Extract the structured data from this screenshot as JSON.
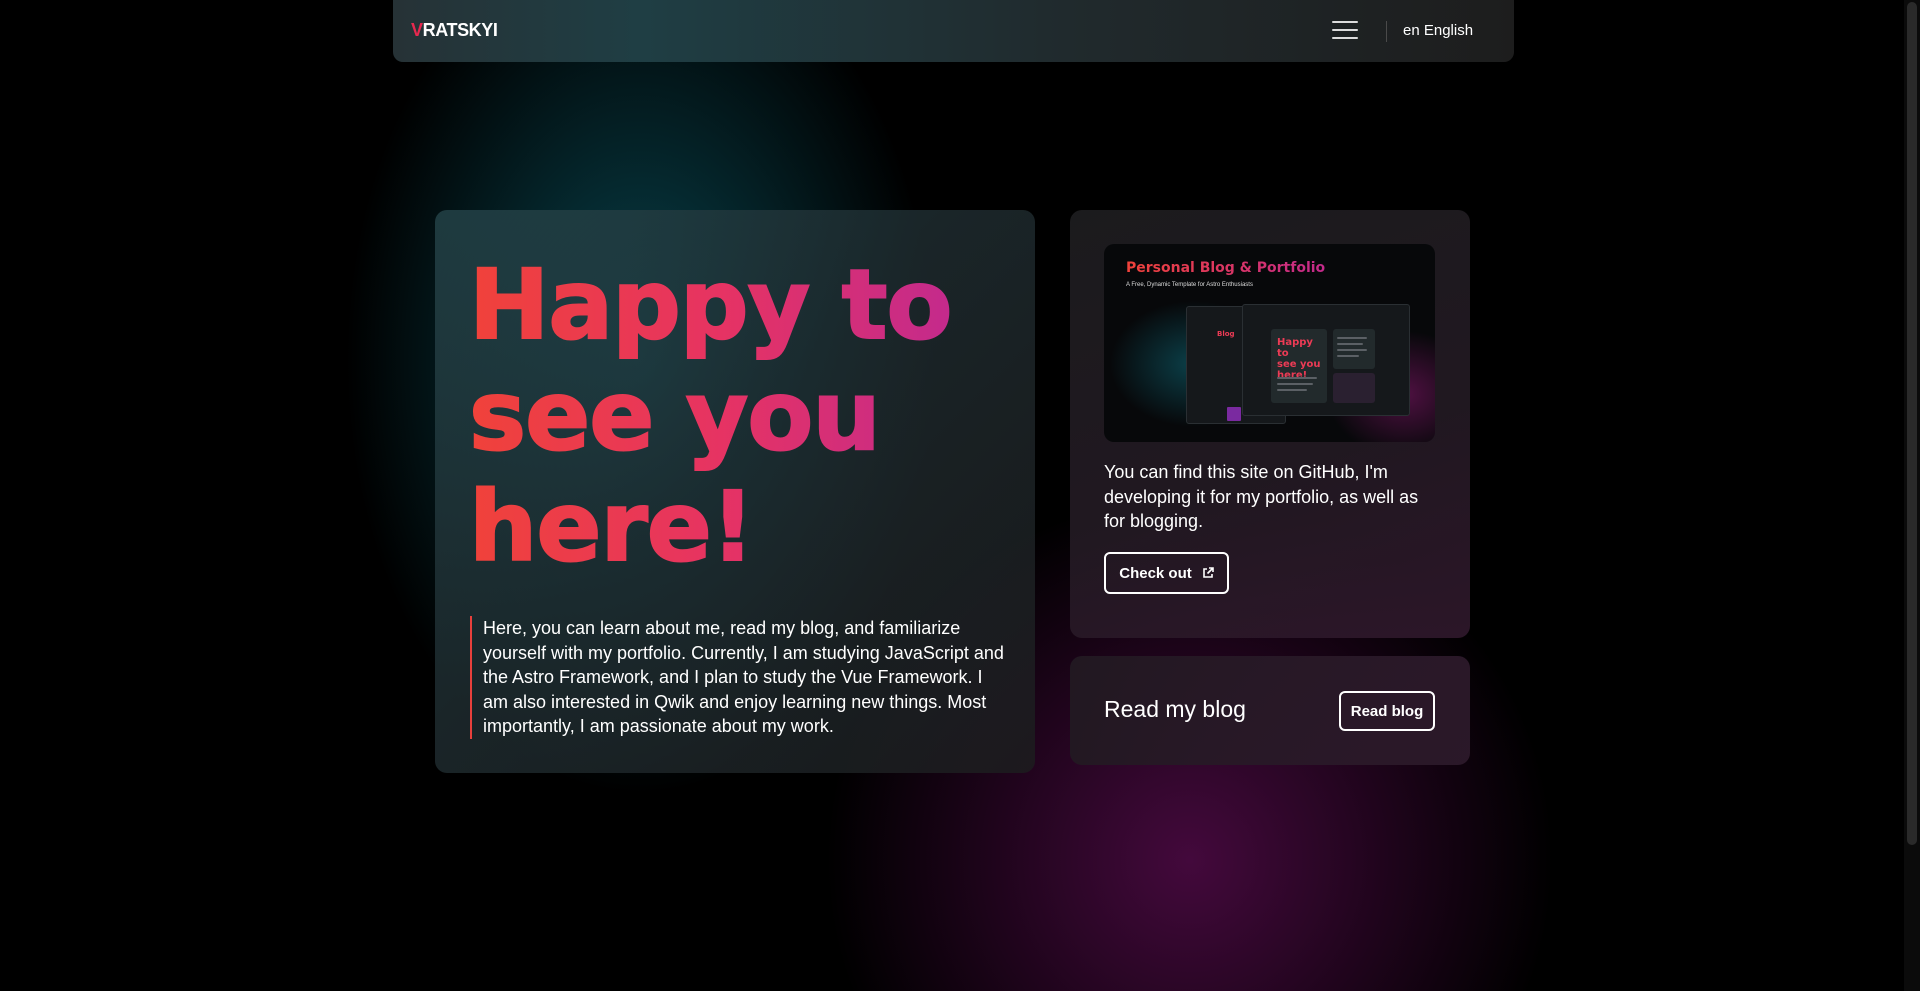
{
  "header": {
    "logo_first": "V",
    "logo_rest": "RATSKYI",
    "menu_icon": "hamburger-menu-icon",
    "language_label": "en English"
  },
  "hero": {
    "title_line1": "Happy to",
    "title_line2": "see you",
    "title_line3": "here!",
    "intro": "Here, you can learn about me, read my blog, and familiarize yourself with my portfolio. Currently, I am studying JavaScript and the Astro Framework, and I plan to study the Vue Framework. I am also interested in Qwik and enjoy learning new things. Most importantly, I am passionate about my work."
  },
  "project": {
    "preview_title": "Personal Blog & Portfolio",
    "preview_subtitle": "A Free, Dynamic Template for Astro Enthusiasts",
    "description": "You can find this site on GitHub, I'm developing it for my portfolio, as well as for blogging.",
    "button_label": "Check out",
    "button_icon": "external-link-icon"
  },
  "blog": {
    "label": "Read my blog",
    "button_label": "Read blog"
  },
  "colors": {
    "accent_red": "#f0423a",
    "accent_pink": "#e63363",
    "accent_magenta": "#b8279a",
    "background": "#000000"
  }
}
